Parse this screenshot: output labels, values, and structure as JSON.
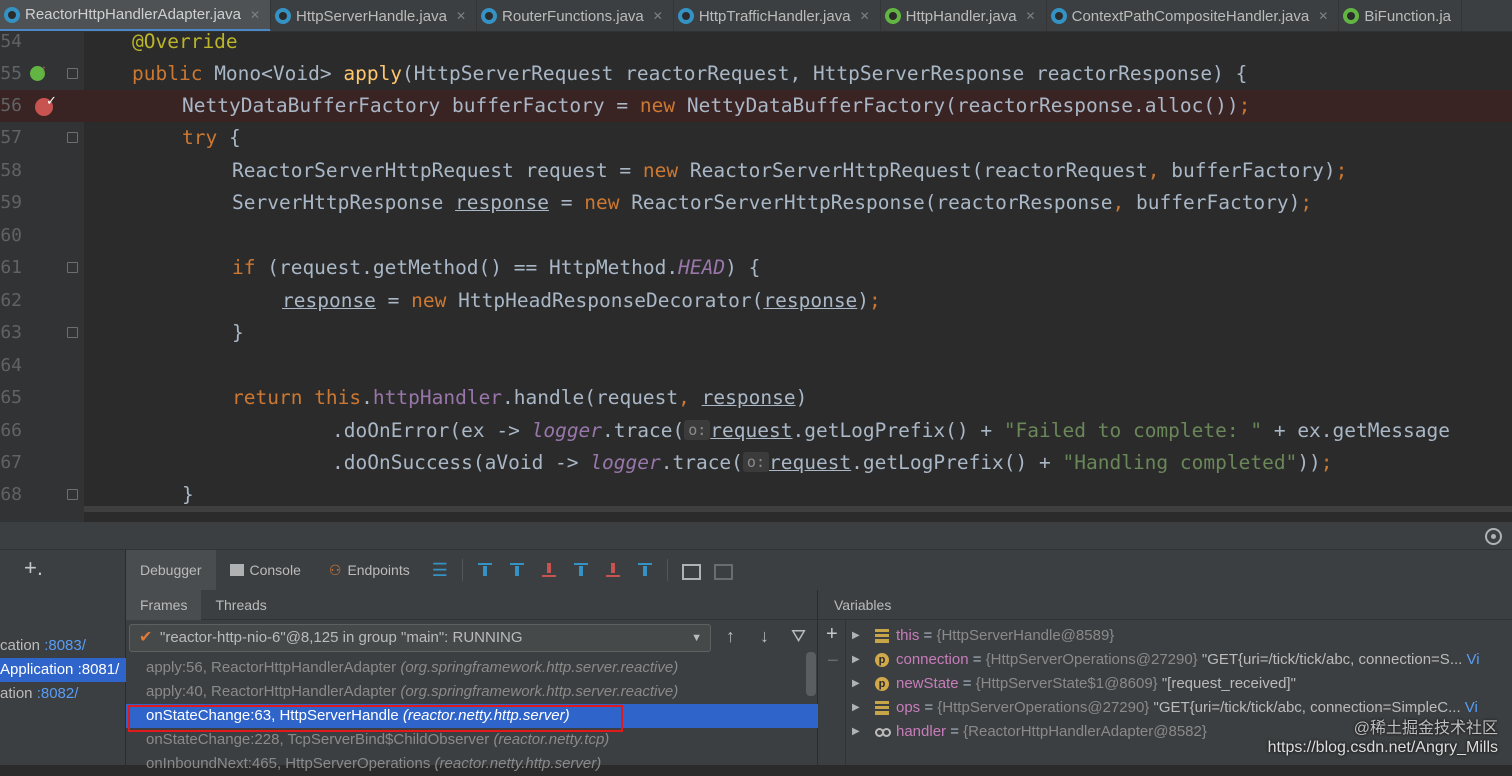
{
  "tabs": [
    {
      "label": "ReactorHttpHandlerAdapter.java",
      "active": true,
      "icon": "class-icon"
    },
    {
      "label": "HttpServerHandle.java",
      "active": false,
      "icon": "class-icon"
    },
    {
      "label": "RouterFunctions.java",
      "active": false,
      "icon": "class-icon"
    },
    {
      "label": "HttpTrafficHandler.java",
      "active": false,
      "icon": "class-icon"
    },
    {
      "label": "HttpHandler.java",
      "active": false,
      "icon": "interface-icon"
    },
    {
      "label": "ContextPathCompositeHandler.java",
      "active": false,
      "icon": "class-icon"
    },
    {
      "label": "BiFunction.ja",
      "active": false,
      "icon": "interface-icon"
    }
  ],
  "editor": {
    "line_numbers": [
      "54",
      "55",
      "56",
      "57",
      "58",
      "59",
      "60",
      "61",
      "62",
      "63",
      "64",
      "65",
      "66",
      "67",
      "68"
    ],
    "code": {
      "l54_anno": "@Override",
      "l55_public": "public",
      "l55_type": " Mono<Void> ",
      "l55_fn": "apply",
      "l55_params": "(HttpServerRequest reactorRequest, HttpServerResponse reactorResponse) {",
      "l56_a": "NettyDataBufferFactory bufferFactory = ",
      "l56_new": "new",
      "l56_b": " NettyDataBufferFactory(reactorResponse.alloc())",
      "l56_semi": ";",
      "l57_try": "try",
      "l57_brace": " {",
      "l58_a": "ReactorServerHttpRequest request = ",
      "l58_new": "new",
      "l58_b": " ReactorServerHttpRequest(reactorRequest",
      "l58_comma": ",",
      "l58_c": " bufferFactory)",
      "l58_semi": ";",
      "l59_a": "ServerHttpResponse ",
      "l59_resp": "response",
      "l59_b": " = ",
      "l59_new": "new",
      "l59_c": " ReactorServerHttpResponse(reactorResponse",
      "l59_comma": ",",
      "l59_d": " bufferFactory)",
      "l59_semi": ";",
      "l61_if": "if",
      "l61_a": " (request.getMethod() == HttpMethod.",
      "l61_head": "HEAD",
      "l61_b": ") {",
      "l62_resp": "response",
      "l62_a": " = ",
      "l62_new": "new",
      "l62_b": " HttpHeadResponseDecorator(",
      "l62_resp2": "response",
      "l62_c": ")",
      "l62_semi": ";",
      "l63_brace": "}",
      "l65_return": "return",
      "l65_this": " this",
      "l65_dot": ".",
      "l65_field": "httpHandler",
      "l65_a": ".handle(request",
      "l65_comma": ",",
      "l65_sp": " ",
      "l65_resp": "response",
      "l65_b": ")",
      "l66_a": ".doOnError(ex -> ",
      "l66_logger": "logger",
      "l66_b": ".trace(",
      "l66_hint": "o:",
      "l66_req": "request",
      "l66_c": ".getLogPrefix() + ",
      "l66_str": "\"Failed to complete: \"",
      "l66_d": " + ex.getMessage",
      "l67_a": ".doOnSuccess(aVoid -> ",
      "l67_logger": "logger",
      "l67_b": ".trace(",
      "l67_hint": "o:",
      "l67_req": "request",
      "l67_c": ".getLogPrefix() + ",
      "l67_str": "\"Handling completed\"",
      "l67_d": "))",
      "l67_semi": ";",
      "l68_brace": "}",
      "l69_partial": "        (                      )   ("
    }
  },
  "debugger": {
    "services": [
      {
        "name": "cation",
        "port": ":8083/",
        "selected": false
      },
      {
        "name": "Application",
        "port": ":8081/",
        "selected": true
      },
      {
        "name": "ation",
        "port": ":8082/",
        "selected": false
      }
    ],
    "toolbar": {
      "debugger_label": "Debugger",
      "console_label": "Console",
      "endpoints_label": "Endpoints"
    },
    "frames_tab": "Frames",
    "threads_tab": "Threads",
    "thread_selected": "\"reactor-http-nio-6\"@8,125 in group \"main\": RUNNING",
    "frames": [
      {
        "method": "apply:56, ReactorHttpHandlerAdapter",
        "pkg": "(org.springframework.http.server.reactive)",
        "selected": false
      },
      {
        "method": "apply:40, ReactorHttpHandlerAdapter",
        "pkg": "(org.springframework.http.server.reactive)",
        "selected": false
      },
      {
        "method": "onStateChange:63, HttpServerHandle",
        "pkg": "(reactor.netty.http.server)",
        "selected": true
      },
      {
        "method": "onStateChange:228, TcpServerBind$ChildObserver",
        "pkg": "(reactor.netty.tcp)",
        "selected": false
      },
      {
        "method": "onInboundNext:465, HttpServerOperations",
        "pkg": "(reactor.netty.http.server)",
        "selected": false
      }
    ],
    "variables_title": "Variables",
    "variables": [
      {
        "icon": "field",
        "name": "this",
        "type": "{HttpServerHandle@8589}",
        "value": "",
        "link": ""
      },
      {
        "icon": "param",
        "name": "connection",
        "type": "{HttpServerOperations@27290}",
        "value": "\"GET{uri=/tick/tick/abc, connection=S...",
        "link": "Vi"
      },
      {
        "icon": "param",
        "name": "newState",
        "type": "{HttpServerState$1@8609}",
        "value": "\"[request_received]\"",
        "link": ""
      },
      {
        "icon": "field",
        "name": "ops",
        "type": "{HttpServerOperations@27290}",
        "value": "\"GET{uri=/tick/tick/abc, connection=SimpleC...",
        "link": "Vi"
      },
      {
        "icon": "ref",
        "name": "handler",
        "type": "{ReactorHttpHandlerAdapter@8582}",
        "value": "",
        "link": ""
      }
    ]
  },
  "watermark": {
    "line1": "@稀土掘金技术社区",
    "line2": "https://blog.csdn.net/Angry_Mills"
  },
  "colors": {
    "editor_bg": "#2b2b2b",
    "keyword": "#cc7832",
    "annotation": "#bbb529",
    "method": "#ffc66d",
    "field": "#9876aa",
    "string": "#6a8759",
    "selection": "#2f65ca",
    "breakpoint": "#c75450",
    "highlight_box": "#e0191f"
  }
}
